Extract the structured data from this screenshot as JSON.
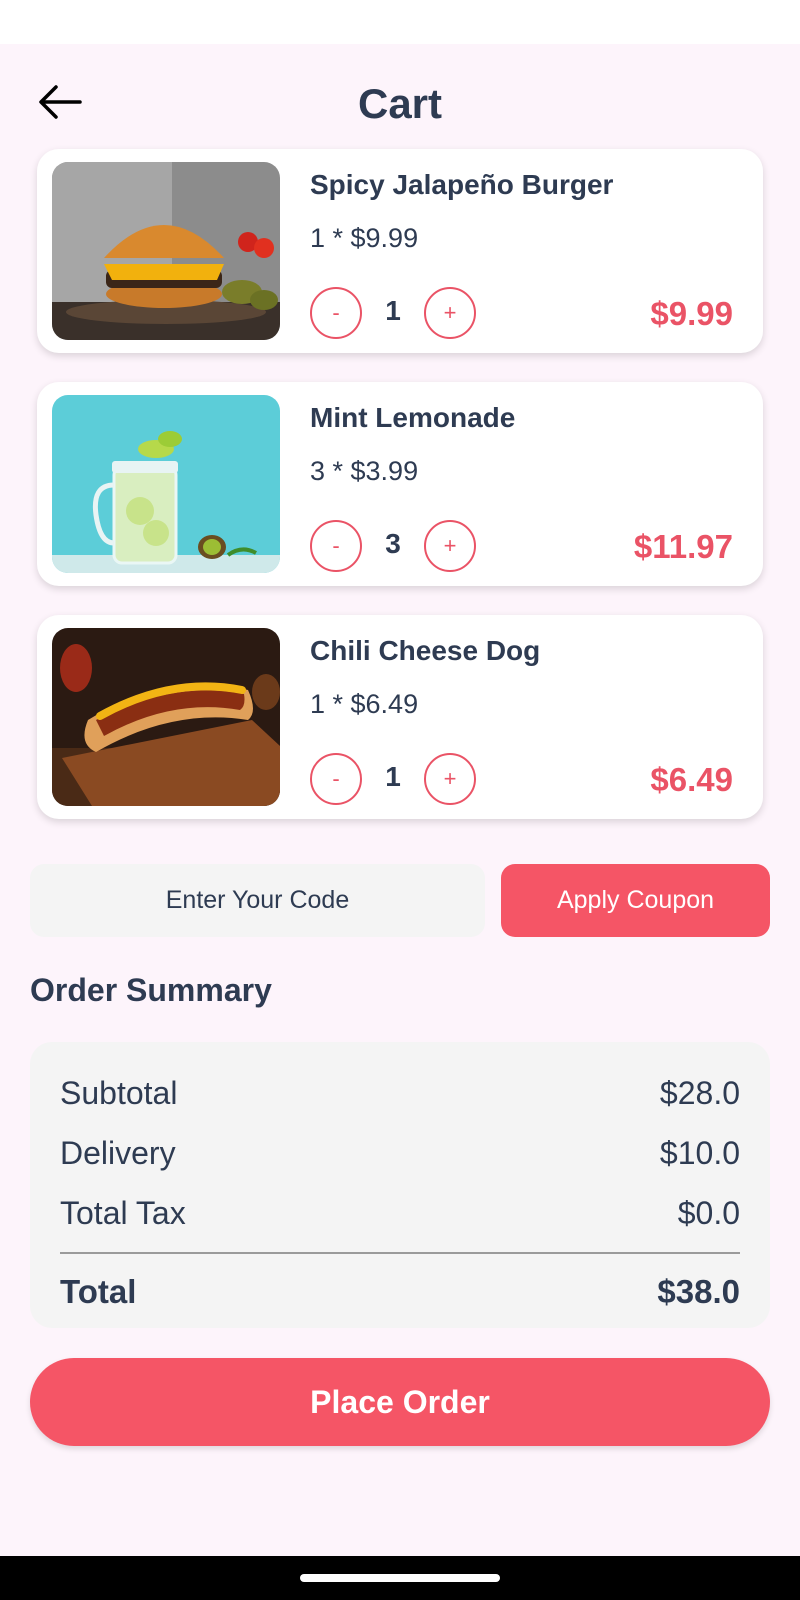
{
  "header": {
    "title": "Cart",
    "back_icon": "arrow-left-icon"
  },
  "cart": {
    "items": [
      {
        "name": "Spicy Jalapeño Burger",
        "unit_line": "1 * $9.99",
        "quantity": "1",
        "total": "$9.99",
        "image": "burger-photo"
      },
      {
        "name": "Mint Lemonade",
        "unit_line": "3 * $3.99",
        "quantity": "3",
        "total": "$11.97",
        "image": "lemonade-photo"
      },
      {
        "name": "Chili Cheese Dog",
        "unit_line": "1 * $6.49",
        "quantity": "1",
        "total": "$6.49",
        "image": "hotdog-photo"
      }
    ],
    "minus_label": "-",
    "plus_label": "+"
  },
  "coupon": {
    "placeholder": "Enter Your Code",
    "button_label": "Apply Coupon"
  },
  "summary": {
    "title": "Order Summary",
    "subtotal_label": "Subtotal",
    "subtotal_value": "$28.0",
    "delivery_label": "Delivery",
    "delivery_value": "$10.0",
    "tax_label": "Total Tax",
    "tax_value": "$0.0",
    "total_label": "Total",
    "total_value": "$38.0"
  },
  "place_order": {
    "label": "Place Order"
  },
  "colors": {
    "accent": "#f55566",
    "text": "#2e3b52",
    "background": "#fdf4fb"
  }
}
